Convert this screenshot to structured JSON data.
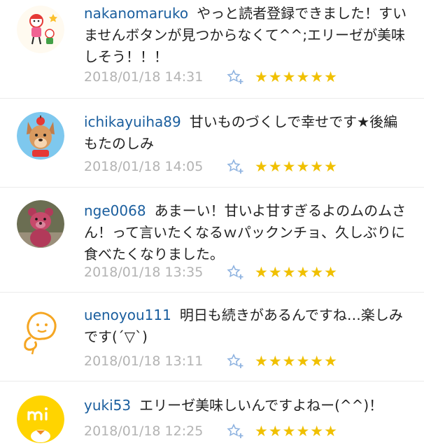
{
  "comments": [
    {
      "username": "nakanomaruko",
      "text": "やっと読者登録できました！すいませんボタンが見つからなくて^^;エリーゼが美味しそう！！！",
      "timestamp": "2018/01/18 14:31",
      "stars": "★★★★★★"
    },
    {
      "username": "ichikayuiha89",
      "text": "甘いものづくしで幸せです★後編もたのしみ",
      "timestamp": "2018/01/18 14:05",
      "stars": "★★★★★★"
    },
    {
      "username": "nge0068",
      "text": "あまーい！甘いよ甘すぎるよのムのムさん！って言いたくなるｗパックンチョ、久しぶりに食べたくなりました。",
      "timestamp": "2018/01/18 13:35",
      "stars": "★★★★★★"
    },
    {
      "username": "uenoyou111",
      "text": "明日も続きがあるんですね…楽しみです(´▽`)",
      "timestamp": "2018/01/18 13:11",
      "stars": "★★★★★★"
    },
    {
      "username": "yuki53",
      "text": "エリーゼ美味しいんですよねー(^^)！",
      "timestamp": "2018/01/18 12:25",
      "stars": "★★★★★★"
    }
  ],
  "colors": {
    "username": "#1a5e9e",
    "timestamp": "#b3b3b3",
    "star": "#f0c000",
    "favorite_icon": "#8fb3e0"
  },
  "icons": {
    "favorite": "star-plus-icon",
    "avatar_1": "child-drawing-avatar",
    "avatar_2": "dog-mascot-avatar",
    "avatar_3": "pink-bear-plush-avatar",
    "avatar_4": "orange-character-avatar",
    "avatar_5": "yellow-chick-logo-avatar"
  }
}
